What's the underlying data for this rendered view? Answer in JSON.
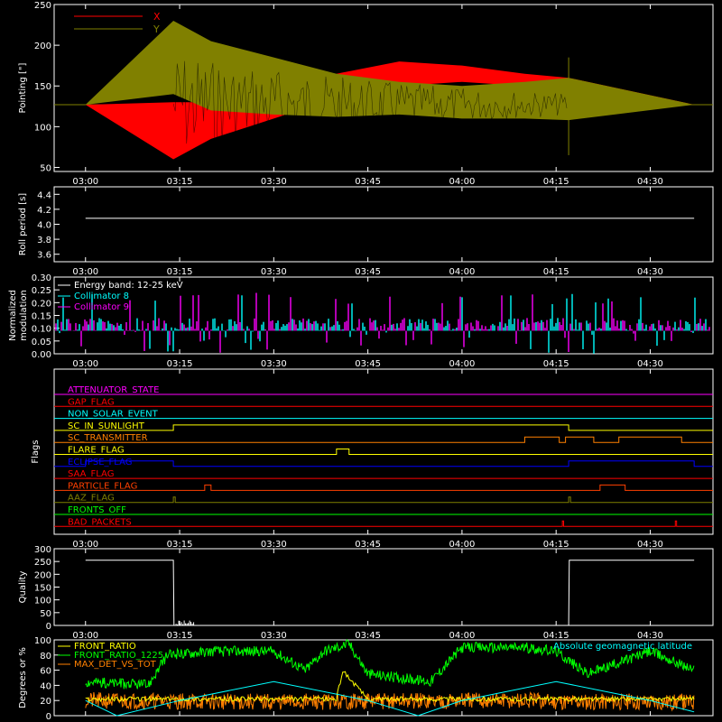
{
  "chart_data": [
    {
      "type": "line",
      "ylabel": "Pointing [\"]",
      "ylim": [
        45,
        250
      ],
      "yticks": [
        50,
        100,
        150,
        200,
        250
      ],
      "xlim_minutes": [
        175,
        280
      ],
      "xticks": [
        "03:00",
        "03:15",
        "03:30",
        "03:45",
        "04:00",
        "04:15",
        "04:30"
      ],
      "legend": [
        {
          "label": "X",
          "color": "#ff0000"
        },
        {
          "label": "Y",
          "color": "#808000"
        }
      ],
      "series": [
        {
          "name": "X",
          "color": "#ff0000",
          "x": [
            "03:00",
            "03:14",
            "03:20",
            "03:30",
            "03:40",
            "03:50",
            "04:00",
            "04:10",
            "04:17",
            "04:37"
          ],
          "y_upper": [
            127,
            130,
            130,
            140,
            165,
            180,
            175,
            165,
            160,
            127
          ],
          "y_lower": [
            127,
            60,
            85,
            110,
            135,
            150,
            155,
            150,
            145,
            127
          ]
        },
        {
          "name": "Y",
          "color": "#808000",
          "x": [
            "03:00",
            "03:14",
            "03:20",
            "03:30",
            "03:40",
            "03:50",
            "04:00",
            "04:10",
            "04:17",
            "04:37"
          ],
          "y_upper": [
            127,
            230,
            205,
            185,
            165,
            155,
            150,
            155,
            160,
            127
          ],
          "y_lower": [
            127,
            140,
            120,
            115,
            112,
            115,
            110,
            110,
            108,
            127
          ]
        }
      ]
    },
    {
      "type": "line",
      "ylabel": "Roll period [s]",
      "ylim": [
        3.5,
        4.5
      ],
      "yticks": [
        3.6,
        3.8,
        4.0,
        4.2,
        4.4
      ],
      "xticks": [
        "03:00",
        "03:15",
        "03:30",
        "03:45",
        "04:00",
        "04:15",
        "04:30"
      ],
      "series": [
        {
          "color": "#ffffff",
          "x": [
            "03:00",
            "04:37"
          ],
          "y": [
            4.08,
            4.08
          ]
        }
      ]
    },
    {
      "type": "bar",
      "ylabel": "Normalized modulation",
      "ylim": [
        0,
        0.3
      ],
      "yticks": [
        0.0,
        0.05,
        0.1,
        0.15,
        0.2,
        0.25,
        0.3
      ],
      "xticks": [
        "03:00",
        "03:15",
        "03:30",
        "03:45",
        "04:00",
        "04:15",
        "04:30"
      ],
      "legend": [
        {
          "label": "Energy band: 12-25 keV",
          "color": "#ffffff"
        },
        {
          "label": "Collimator 8",
          "color": "#00ffff"
        },
        {
          "label": "Collimator 9",
          "color": "#ff00ff"
        }
      ],
      "baseline": 0.09
    },
    {
      "type": "line",
      "ylabel": "Flags",
      "xticks": [
        "03:00",
        "03:15",
        "03:30",
        "03:45",
        "04:00",
        "04:15",
        "04:30"
      ],
      "flags": [
        {
          "label": "ATTENUATOR_STATE",
          "color": "#ff00ff",
          "on": []
        },
        {
          "label": "GAP_FLAG",
          "color": "#ff0000",
          "on": []
        },
        {
          "label": "NON_SOLAR_EVENT",
          "color": "#00ffff",
          "on": []
        },
        {
          "label": "SC_IN_SUNLIGHT",
          "color": "#ffff00",
          "on": [
            [
              "03:14",
              "04:17"
            ]
          ]
        },
        {
          "label": "SC_TRANSMITTER",
          "color": "#ff8000",
          "on": [
            [
              "04:10",
              "04:15.5"
            ],
            [
              "04:16.5",
              "04:21"
            ],
            [
              "04:25",
              "04:35"
            ]
          ]
        },
        {
          "label": "FLARE_FLAG",
          "color": "#ffff00",
          "on": [
            [
              "03:40",
              "03:42"
            ]
          ]
        },
        {
          "label": "ECLIPSE_FLAG",
          "color": "#0000ff",
          "on": [
            [
              "03:00",
              "03:14"
            ],
            [
              "04:17",
              "04:37"
            ]
          ]
        },
        {
          "label": "SAA_FLAG",
          "color": "#ff0000",
          "on": []
        },
        {
          "label": "PARTICLE_FLAG",
          "color": "#ff4000",
          "on": [
            [
              "03:19",
              "03:20"
            ],
            [
              "04:22",
              "04:26"
            ]
          ]
        },
        {
          "label": "AAZ_FLAG",
          "color": "#808000",
          "on": [
            [
              "03:14",
              "03:14.3"
            ],
            [
              "04:17",
              "04:17.3"
            ]
          ]
        },
        {
          "label": "FRONTS_OFF",
          "color": "#00ff00",
          "on": []
        },
        {
          "label": "BAD_PACKETS",
          "color": "#ff0000",
          "on": [
            [
              "04:16",
              "04:16.2"
            ],
            [
              "04:34",
              "04:34.2"
            ]
          ]
        }
      ]
    },
    {
      "type": "line",
      "ylabel": "Quality",
      "ylim": [
        0,
        300
      ],
      "yticks": [
        0,
        50,
        100,
        150,
        200,
        250,
        300
      ],
      "xticks": [
        "03:00",
        "03:15",
        "03:30",
        "03:45",
        "04:00",
        "04:15",
        "04:30"
      ],
      "series": [
        {
          "color": "#ffffff",
          "x": [
            "03:00",
            "03:14",
            "03:14.1",
            "04:17",
            "04:17.1",
            "04:37"
          ],
          "y": [
            255,
            255,
            0,
            0,
            255,
            255
          ]
        }
      ]
    },
    {
      "type": "line",
      "ylabel": "Degrees or %",
      "ylim": [
        0,
        100
      ],
      "yticks": [
        0,
        20,
        40,
        60,
        80,
        100
      ],
      "xticks": [
        "03:00",
        "03:15",
        "03:30",
        "03:45",
        "04:00",
        "04:15",
        "04:30"
      ],
      "legend": [
        {
          "label": "FRONT_RATIO",
          "color": "#ffff00"
        },
        {
          "label": "FRONT_RATIO_1225",
          "color": "#00ff00"
        },
        {
          "label": "MAX_DET_VS_TOT",
          "color": "#ff8000"
        }
      ],
      "annotation": {
        "label": "Absolute geomagnetic latitude",
        "color": "#00ffff"
      },
      "series": [
        {
          "name": "FRONT_RATIO_1225",
          "color": "#00ff00",
          "x": [
            "03:00",
            "03:10",
            "03:13",
            "03:20",
            "03:30",
            "03:35",
            "03:38",
            "03:42",
            "03:45",
            "03:50",
            "03:55",
            "04:00",
            "04:10",
            "04:15",
            "04:20",
            "04:30",
            "04:37"
          ],
          "y": [
            45,
            40,
            80,
            85,
            85,
            60,
            85,
            95,
            55,
            50,
            45,
            90,
            90,
            85,
            55,
            85,
            60
          ]
        },
        {
          "name": "FRONT_RATIO",
          "color": "#ffff00",
          "x": [
            "03:00",
            "03:40",
            "03:41",
            "03:43",
            "03:45",
            "04:37"
          ],
          "y": [
            22,
            22,
            60,
            40,
            22,
            22
          ]
        },
        {
          "name": "MAX_DET_VS_TOT",
          "color": "#ff8000",
          "x": [
            "03:00",
            "03:30",
            "04:00",
            "04:37"
          ],
          "y": [
            20,
            18,
            20,
            18
          ]
        },
        {
          "name": "Absolute geomagnetic latitude",
          "color": "#00ffff",
          "x": [
            "03:00",
            "03:05",
            "03:15",
            "03:30",
            "03:45",
            "03:53",
            "04:00",
            "04:15",
            "04:30",
            "04:37"
          ],
          "y": [
            20,
            0,
            20,
            45,
            20,
            0,
            20,
            45,
            20,
            5
          ]
        }
      ]
    }
  ]
}
